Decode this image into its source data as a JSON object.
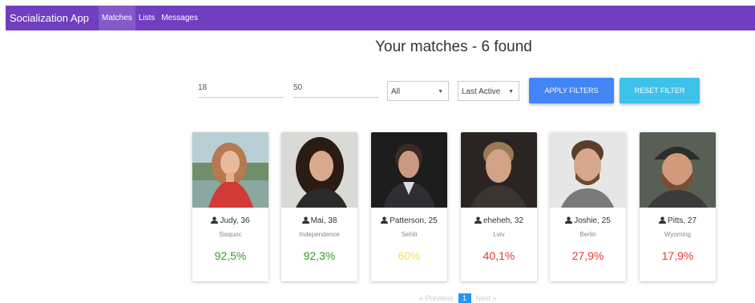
{
  "navbar": {
    "brand": "Socialization App",
    "items": [
      "Matches",
      "Lists",
      "Messages"
    ]
  },
  "page": {
    "title": "Your matches - 6 found"
  },
  "filters": {
    "min_age": "18",
    "max_age": "50",
    "gender": "All",
    "order_by": "Last Active",
    "apply_label": "APPLY FILTERS",
    "reset_label": "RESET FILTER"
  },
  "matches": [
    {
      "name": "Judy, 36",
      "city": "Sisquoc",
      "score": "92,5%"
    },
    {
      "name": "Mai, 38",
      "city": "Independence",
      "score": "92,3%"
    },
    {
      "name": "Patterson, 25",
      "city": "Sehili",
      "score": "60%"
    },
    {
      "name": "eheheh, 32",
      "city": "Lviv",
      "score": "40,1%"
    },
    {
      "name": "Joshie, 25",
      "city": "Berlin",
      "score": "27,9%"
    },
    {
      "name": "Pitts, 27",
      "city": "Wyoming",
      "score": "17,9%"
    }
  ],
  "pagination": {
    "previous": "« Previous",
    "current": "1",
    "next": "Next »"
  },
  "colors": {
    "navbar": "#6f3fc0",
    "apply": "#4285f4",
    "reset": "#3ec2ea",
    "score_high": "#3c9a2c",
    "score_mid": "#f2e24a",
    "score_low": "#e53935"
  }
}
